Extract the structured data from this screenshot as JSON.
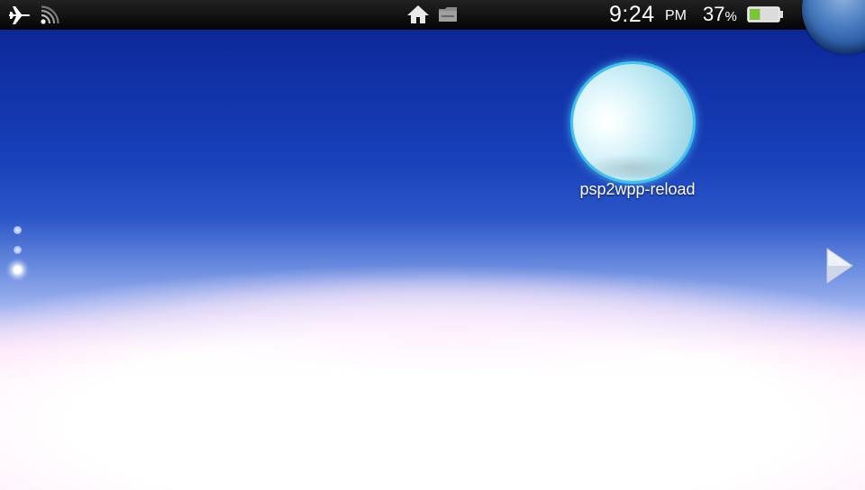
{
  "status_bar": {
    "airplane_icon": "airplane-icon",
    "wifi_icon": "wifi-icon",
    "home_icon": "home-icon",
    "folder_icon": "folder-icon",
    "time": "9:24",
    "ampm": "PM",
    "battery_percent": "37",
    "battery_percent_sign": "%",
    "battery_level": 0.37,
    "battery_color": "#7cc43a"
  },
  "home_screen": {
    "apps": [
      {
        "label": "psp2wpp-reload",
        "icon": "bubble-icon"
      }
    ],
    "pages": {
      "count": 3,
      "current": 3
    },
    "next_page_icon": "chevron-right-icon"
  },
  "colors": {
    "sky_top": "#0b1f86",
    "sky_mid": "#2a55c8",
    "bubble_glow": "#3dc4ee"
  }
}
